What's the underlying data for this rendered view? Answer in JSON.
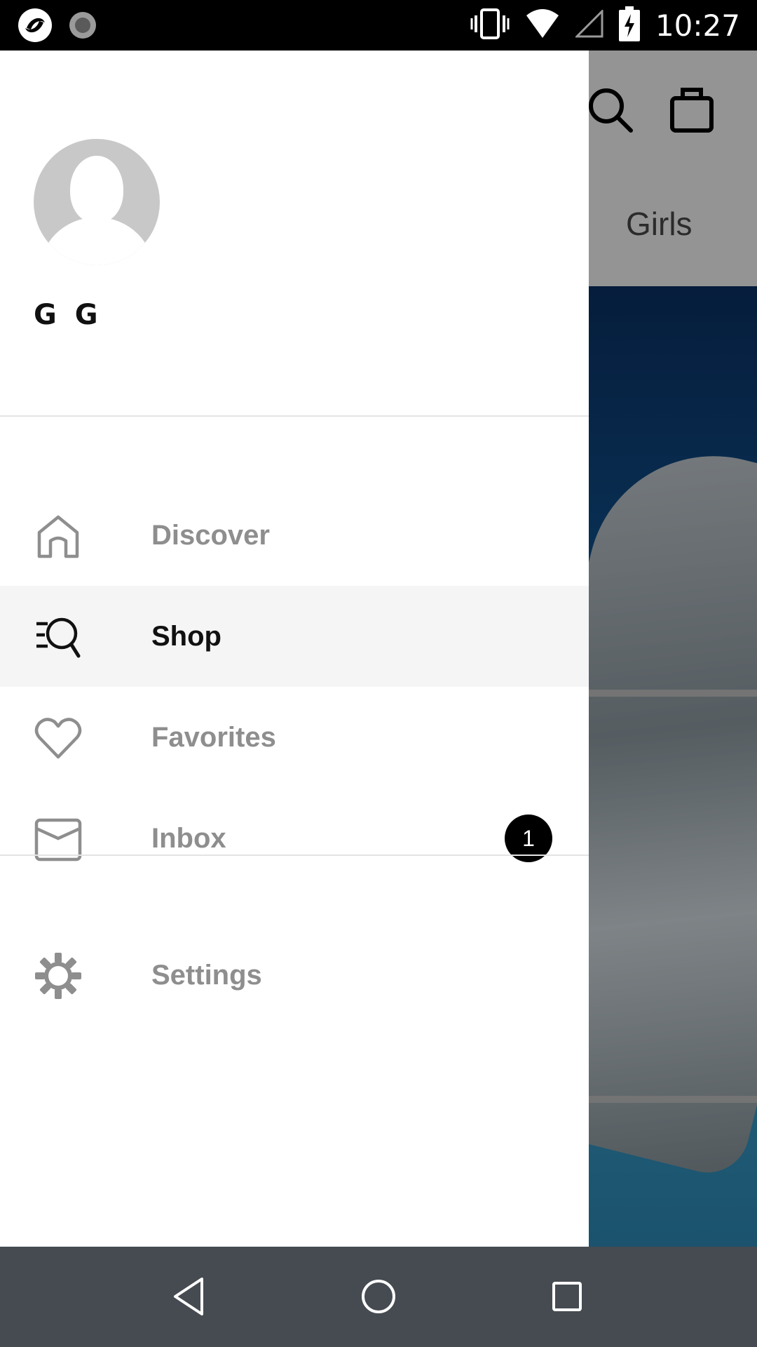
{
  "status_bar": {
    "time": "10:27",
    "icons": [
      "app-logo-icon",
      "sync-icon",
      "vibrate-icon",
      "wifi-icon",
      "signal-icon",
      "battery-charging-icon"
    ]
  },
  "background_app": {
    "header_icons": [
      "search-icon",
      "shopping-bag-icon"
    ],
    "tab_visible": "Girls"
  },
  "drawer": {
    "user": {
      "name": "G G",
      "avatar": "default-avatar-icon"
    },
    "menu": [
      {
        "label": "Discover",
        "icon": "home-icon",
        "active": false
      },
      {
        "label": "Shop",
        "icon": "shop-search-icon",
        "active": true
      },
      {
        "label": "Favorites",
        "icon": "heart-icon",
        "active": false
      },
      {
        "label": "Inbox",
        "icon": "inbox-icon",
        "active": false,
        "badge": "1"
      }
    ],
    "settings": {
      "label": "Settings",
      "icon": "gear-icon"
    }
  },
  "nav_bar": {
    "buttons": [
      "back-icon",
      "home-circle-icon",
      "recents-icon"
    ]
  },
  "colors": {
    "active_row": "#f5f5f5",
    "inactive_label": "#8e8e8e",
    "active_label": "#111111",
    "badge": "#000000",
    "nav_bar": "#454b51"
  }
}
